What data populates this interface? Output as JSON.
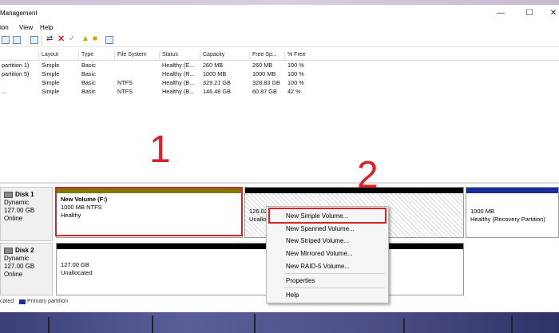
{
  "window": {
    "title": "Management",
    "controls": [
      "—",
      "☐",
      "✕"
    ]
  },
  "menu": [
    "ion",
    "View",
    "Help"
  ],
  "toolbar_icons": [
    "back-icon",
    "forward-icon",
    "properties-icon",
    "help-icon",
    "connect-icon",
    "delete-icon",
    "check-icon",
    "new-icon",
    "folder-icon",
    "list-icon"
  ],
  "volumes": {
    "headers": [
      "Layout",
      "Type",
      "File System",
      "Status",
      "Capacity",
      "Free Sp...",
      "% Free"
    ],
    "rows": [
      {
        "name": " partition 1)",
        "layout": "Simple",
        "type": "Basic",
        "fs": "",
        "status": "Healthy (E...",
        "capacity": "260 MB",
        "free": "260 MB",
        "pct": "100 %"
      },
      {
        "name": " partition 5)",
        "layout": "Simple",
        "type": "Basic",
        "fs": "",
        "status": "Healthy (R...",
        "capacity": "1000 MB",
        "free": "1000 MB",
        "pct": "100 %"
      },
      {
        "name": "",
        "layout": "Simple",
        "type": "Basic",
        "fs": "NTFS",
        "status": "Healthy (B...",
        "capacity": "329.21 GB",
        "free": "328.83 GB",
        "pct": "100 %"
      },
      {
        "name": "...",
        "layout": "Simple",
        "type": "Basic",
        "fs": "NTFS",
        "status": "Healthy (B...",
        "capacity": "146.48 GB",
        "free": "60.87 GB",
        "pct": "42 %"
      }
    ]
  },
  "disks": [
    {
      "name": "Disk 1",
      "kind": "Dynamic",
      "size": "127.00 GB",
      "state": "Online",
      "partitions": [
        {
          "title": "New Volume  (F:)",
          "line1": "1000 MB NTFS",
          "line2": "Healthy",
          "color": "#7c7a00"
        },
        {
          "title": "",
          "line1": "126.02 GB",
          "line2": "Unalloc",
          "color": "#000000"
        },
        {
          "title": "",
          "line1": "1000 MB",
          "line2": "Healthy (Recovery Partition)",
          "color": "#1a2e9c"
        }
      ]
    },
    {
      "name": "Disk 2",
      "kind": "Dynamic",
      "size": "127.00 GB",
      "state": "Online",
      "partitions": [
        {
          "title": "",
          "line1": "127.00 GB",
          "line2": "Unallocated",
          "color": "#000000"
        }
      ]
    }
  ],
  "legend": {
    "unallocated": "cated",
    "primary": "Primary partition",
    "primary_color": "#1a2e9c"
  },
  "context_menu": {
    "items": [
      "New Simple Volume...",
      "New Spanned Volume...",
      "New Striped Volume...",
      "New Mirrored Volume...",
      "New RAID-5 Volume..."
    ],
    "properties": "Properties",
    "help": "Help"
  },
  "annotations": {
    "step1": "1",
    "step2": "2",
    "color": "#d8232a"
  }
}
